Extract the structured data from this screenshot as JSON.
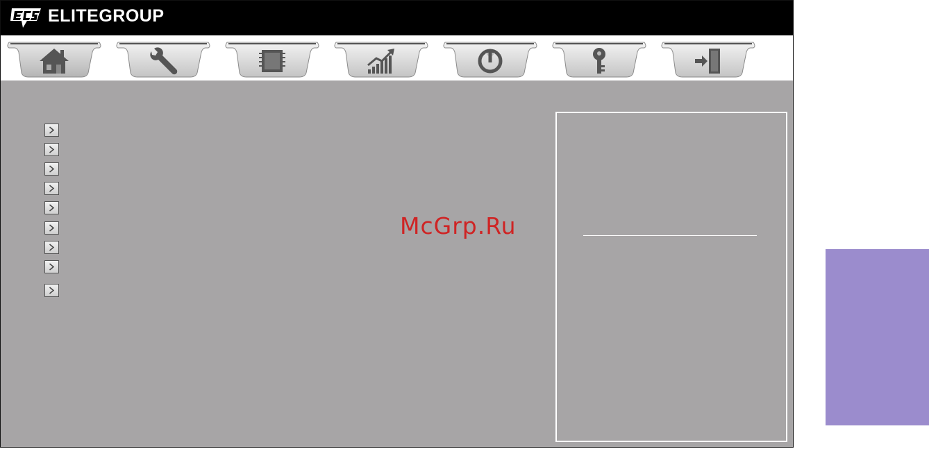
{
  "brand": {
    "name": "ELITEGROUP",
    "logo_text": "ECS"
  },
  "tabs": [
    {
      "name": "main",
      "icon": "home-icon",
      "active": true
    },
    {
      "name": "advanced",
      "icon": "wrench-icon",
      "active": false
    },
    {
      "name": "chipset",
      "icon": "chip-icon",
      "active": false
    },
    {
      "name": "mi",
      "icon": "performance-chart-icon",
      "active": false
    },
    {
      "name": "boot",
      "icon": "power-icon",
      "active": false
    },
    {
      "name": "security",
      "icon": "key-icon",
      "active": false
    },
    {
      "name": "exit",
      "icon": "exit-icon",
      "active": false
    }
  ],
  "menu_items": [
    {
      "label": ""
    },
    {
      "label": ""
    },
    {
      "label": ""
    },
    {
      "label": ""
    },
    {
      "label": ""
    },
    {
      "label": ""
    },
    {
      "label": ""
    },
    {
      "label": ""
    },
    {
      "label": ""
    }
  ],
  "watermark": {
    "text": "McGrp.Ru"
  },
  "colors": {
    "background": "#a7a5a6",
    "title_bar": "#000000",
    "watermark": "#cf2424",
    "side_tab": "#9b8ccd"
  }
}
